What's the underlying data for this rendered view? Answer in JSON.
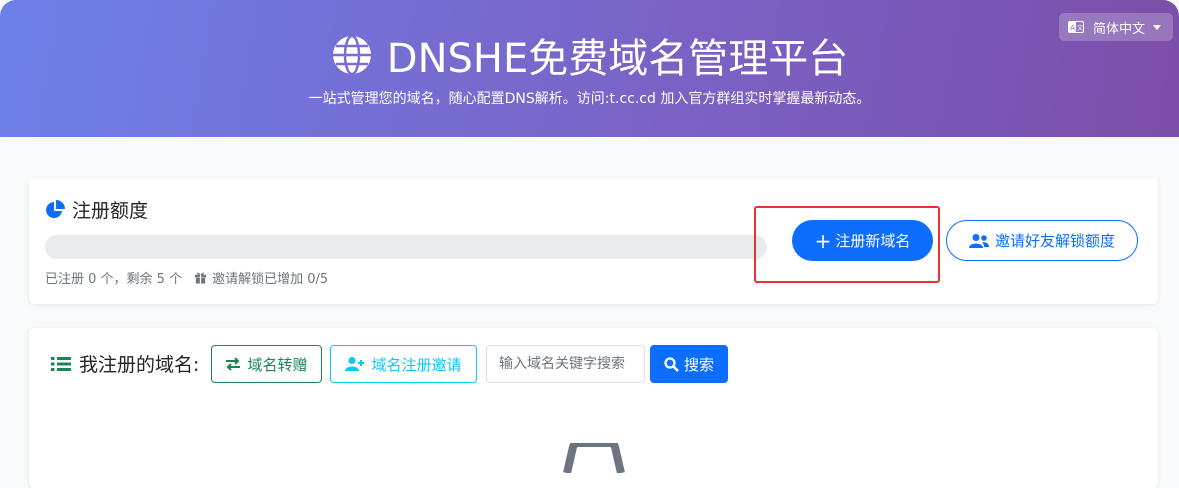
{
  "header": {
    "title": "DNSHE免费域名管理平台",
    "subtitle": "一站式管理您的域名，随心配置DNS解析。访问:t.cc.cd 加入官方群组实时掌握最新动态。",
    "language": "简体中文",
    "gradient_start": "#6d80e8",
    "gradient_end": "#7b4ea8"
  },
  "quota": {
    "title": "注册额度",
    "progress": 0,
    "registered_text": "已注册 0 个，剩余 5 个",
    "invite_text": "邀请解锁已增加 0/5",
    "register_button": "注册新域名",
    "invite_button": "邀请好友解锁额度"
  },
  "domains": {
    "title": "我注册的域名:",
    "transfer_button": "域名转赠",
    "reg_invite_button": "域名注册邀请",
    "search_placeholder": "输入域名关键字搜索",
    "search_button": "搜索"
  },
  "colors": {
    "primary": "#0d6efd",
    "success": "#198754",
    "info": "#0dcaf0",
    "highlight": "#e8322f"
  },
  "icons": [
    "globe-icon",
    "translate-icon",
    "chart-pie-icon",
    "gift-icon",
    "plus-icon",
    "users-icon",
    "list-icon",
    "exchange-icon",
    "user-plus-icon",
    "search-icon",
    "empty-state-icon"
  ]
}
